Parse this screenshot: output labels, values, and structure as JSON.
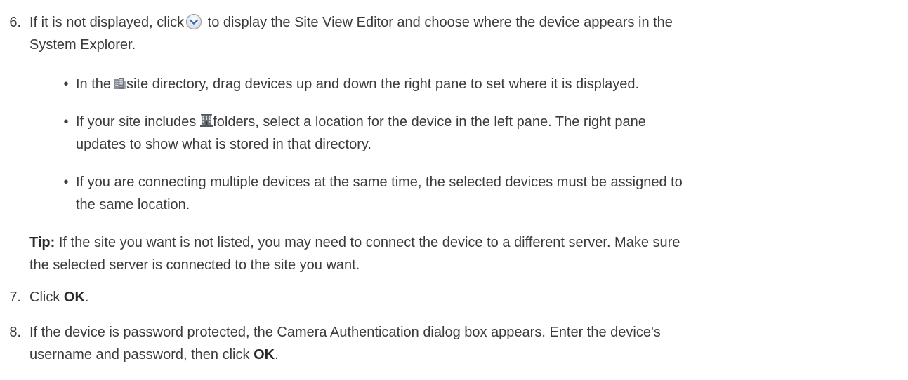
{
  "step6": {
    "number": "6.",
    "text_before_icon": "If it is not displayed, click",
    "text_after_icon": "to display the Site View Editor and choose where the device appears in the",
    "text_line2": "System Explorer.",
    "icons": {
      "expand": "expand-chevron-circle-icon"
    },
    "bullets": [
      {
        "before_icon": "In the",
        "icon": "site-building-icon",
        "after_icon": "site directory, drag devices up and down the right pane to set where it is displayed."
      },
      {
        "before_icon": "If your site includes",
        "icon": "site-folder-building-icon",
        "after_icon": "folders, select a location for the device in the left pane. The right pane",
        "line2": "updates to show what is stored in that directory."
      },
      {
        "line1": "If you are connecting multiple devices at the same time, the selected devices must be assigned to",
        "line2": "the same location."
      }
    ],
    "tip": {
      "label": "Tip:",
      "line1": "If the site you want is not listed, you may need to connect the device to a different server. Make sure",
      "line2": "the selected server is connected to the site you want."
    }
  },
  "step7": {
    "number": "7.",
    "text": "Click",
    "bold": "OK",
    "end": "."
  },
  "step8": {
    "number": "8.",
    "line1": "If the device is password protected, the Camera Authentication dialog box appears. Enter the device's",
    "line2": "username and password, then click",
    "bold": "OK",
    "end": "."
  },
  "colors": {
    "text": "#3b3b3b",
    "icon_blue": "#2f6fb5",
    "icon_gray": "#8a8f96"
  }
}
